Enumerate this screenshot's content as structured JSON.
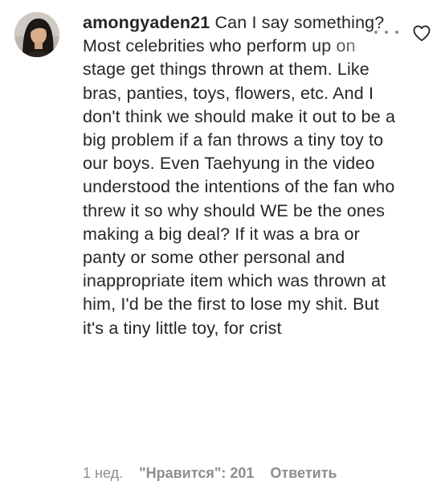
{
  "comment": {
    "username": "amongyaden21",
    "text": "Can I say something? Most celebrities who perform up on stage get things thrown at them. Like bras, panties, toys, flowers, etc. And I don't think we should make it out to be a big problem if a fan throws a tiny toy to our boys. Even Taehyung in the video understood the intentions of the fan who threw it so why should WE be the ones making a big deal? If it was a bra or panty or some other personal and inappropriate item which was thrown at him, I'd be the first to lose my shit. But it's a tiny little toy, for crist",
    "time_ago": "1 нед.",
    "likes_label": "\"Нравится\": 201",
    "reply_label": "Ответить"
  },
  "icons": {
    "more": "more-horizontal-icon",
    "like": "heart-outline-icon"
  },
  "colors": {
    "text": "#262626",
    "meta": "#8e8e8e"
  }
}
